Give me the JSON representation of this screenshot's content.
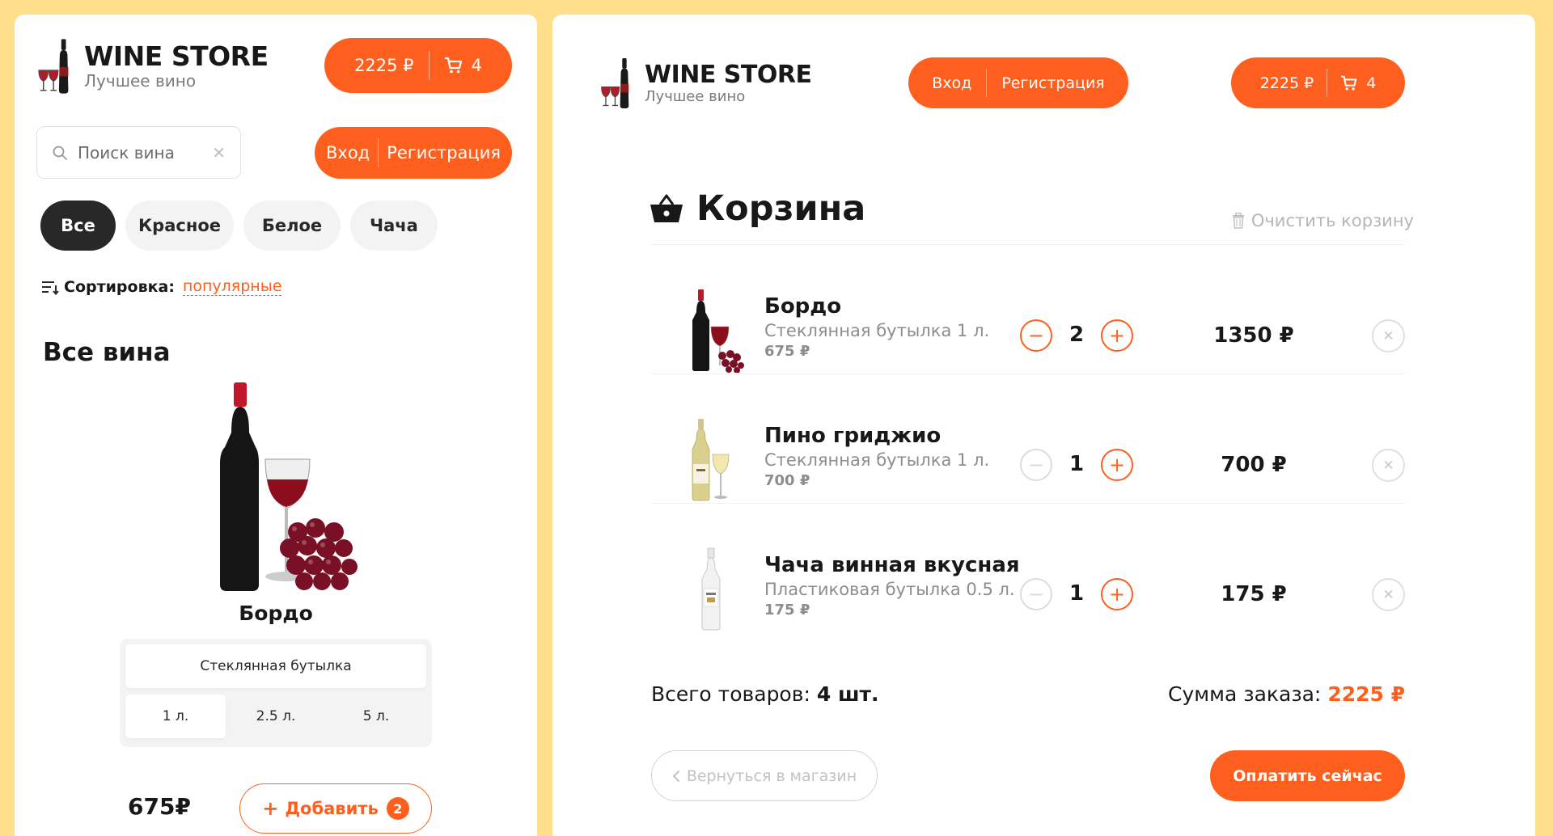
{
  "colors": {
    "accent": "#FE5F1E",
    "background": "#FFDF8C",
    "dark": "#282828"
  },
  "left": {
    "logo": {
      "title": "WINE STORE",
      "subtitle": "Лучшее вино",
      "icon": "wine-bottle-icon"
    },
    "cart_button": {
      "price": "2225 ₽",
      "count": "4",
      "icon": "cart-icon"
    },
    "search": {
      "placeholder": "Поиск вина",
      "icon": "search-icon",
      "clear_icon": "close-icon"
    },
    "auth": {
      "login": "Вход",
      "register": "Регистрация"
    },
    "categories": [
      "Все",
      "Красное",
      "Белое",
      "Чача"
    ],
    "active_category": "Все",
    "sort": {
      "label": "Сортировка:",
      "value": "популярные",
      "icon": "sort-icon"
    },
    "section_title": "Все вина",
    "product": {
      "name": "Бордо",
      "type_option": "Стеклянная бутылка",
      "sizes": [
        "1 л.",
        "2.5 л.",
        "5 л."
      ],
      "active_size": "1 л.",
      "price": "675₽",
      "add_label": "Добавить",
      "add_count": "2"
    }
  },
  "right": {
    "logo": {
      "title": "WINE STORE",
      "subtitle": "Лучшее вино",
      "icon": "wine-bottle-icon"
    },
    "auth": {
      "login": "Вход",
      "register": "Регистрация"
    },
    "cart_button": {
      "price": "2225 ₽",
      "count": "4",
      "icon": "cart-icon"
    },
    "cart_title": "Корзина",
    "clear_label": "Очистить корзину",
    "items": [
      {
        "name": "Бордо",
        "desc": "Стеклянная бутылка 1 л.",
        "unit": "675 ₽",
        "qty": "2",
        "sum": "1350 ₽",
        "minus_enabled": true,
        "image": "red-wine-bottle"
      },
      {
        "name": "Пино гриджио",
        "desc": "Стеклянная бутылка 1 л.",
        "unit": "700 ₽",
        "qty": "1",
        "sum": "700 ₽",
        "minus_enabled": false,
        "image": "white-wine-bottle"
      },
      {
        "name": "Чача винная вкусная",
        "desc": "Пластиковая бутылка 0.5 л.",
        "unit": "175 ₽",
        "qty": "1",
        "sum": "175 ₽",
        "minus_enabled": false,
        "image": "chacha-bottle"
      }
    ],
    "total_count_label": "Всего товаров:",
    "total_count_value": "4 шт.",
    "total_sum_label": "Сумма заказа:",
    "total_sum_value": "2225 ₽",
    "back_label": "Вернуться в магазин",
    "pay_label": "Оплатить сейчас"
  }
}
